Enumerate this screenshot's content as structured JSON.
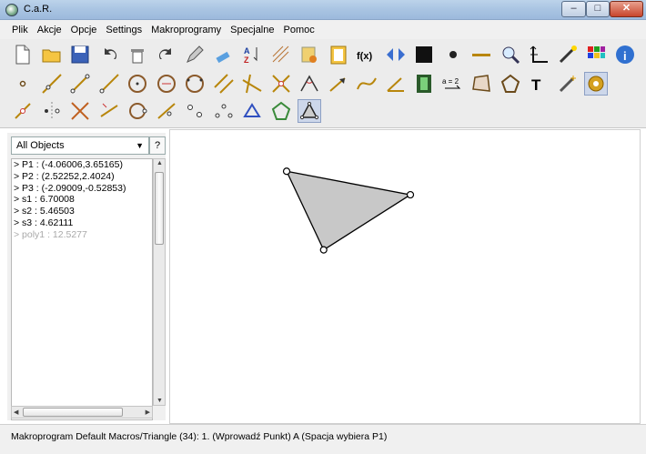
{
  "window": {
    "title": "C.a.R.",
    "minimize": "–",
    "maximize": "□",
    "close": "✕"
  },
  "menu": [
    "Plik",
    "Akcje",
    "Opcje",
    "Settings",
    "Makroprogramy",
    "Specjalne",
    "Pomoc"
  ],
  "toolbar": {
    "fx_label": "f(x)",
    "a2_label": "a = 2",
    "text_tool_label": "T",
    "rows": [
      [
        "new-file",
        "open-file",
        "save-file",
        "undo",
        "delete",
        "redo",
        "edit",
        "wipe",
        "sort-az",
        "grid",
        "macro-run",
        "clipboard",
        "function",
        "play-both",
        "black-square",
        "point-dot",
        "line-dash",
        "zoom",
        "axes",
        "wand",
        "color-grid",
        "info"
      ],
      [
        "point",
        "line-through",
        "segment",
        "ray",
        "circle",
        "circle-fixed",
        "circle-3",
        "parallel",
        "perpendicular",
        "intersection",
        "angle",
        "vector",
        "curve",
        "fixed-angle",
        "film",
        "expression",
        "quadrilateral",
        "polygon",
        "text",
        "tool-magic",
        "settings-gear"
      ],
      [
        "midpoint",
        "mirror",
        "cross-lines",
        "line-2",
        "circle-point",
        "line-point",
        "points-2",
        "points-3",
        "triangle-tool",
        "pentagon",
        "triangle-polygon"
      ]
    ]
  },
  "sidebar": {
    "filter": "All Objects",
    "help": "?",
    "objects": [
      {
        "text": "> P1 : (-4.06006,3.65165)",
        "hidden": false
      },
      {
        "text": "> P2 : (2.52252,2.4024)",
        "hidden": false
      },
      {
        "text": "> P3 : (-2.09009,-0.52853)",
        "hidden": false
      },
      {
        "text": "> s1 : 6.70008",
        "hidden": false
      },
      {
        "text": "> s2 : 5.46503",
        "hidden": false
      },
      {
        "text": "> s3 : 4.62111",
        "hidden": false
      },
      {
        "text": "> poly1 : 12.5277",
        "hidden": true
      }
    ]
  },
  "construction": {
    "points": [
      {
        "name": "P1",
        "x": -4.06006,
        "y": 3.65165
      },
      {
        "name": "P2",
        "x": 2.52252,
        "y": 2.4024
      },
      {
        "name": "P3",
        "x": -2.09009,
        "y": -0.52853
      }
    ],
    "polygon_fill": "#c8c8c8",
    "stroke": "#000000"
  },
  "status": "Makroprogram Default Macros/Triangle (34): 1. (Wprowadź Punkt) A  (Spacja wybiera P1)"
}
